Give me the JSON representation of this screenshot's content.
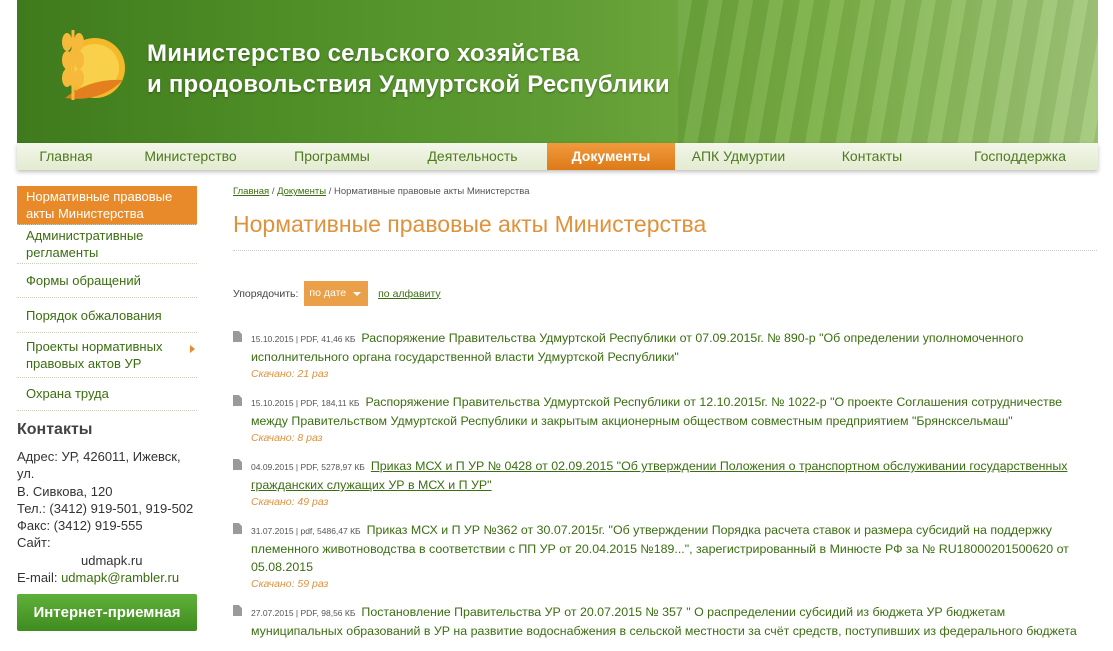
{
  "header": {
    "title_line1": "Министерство сельского хозяйства",
    "title_line2": "и продовольствия Удмуртской Республики"
  },
  "nav": {
    "items": [
      "Главная",
      "Министерство",
      "Программы",
      "Деятельность",
      "Документы",
      "АПК Удмуртии",
      "Контакты",
      "Господдержка"
    ],
    "active": "Документы"
  },
  "sidebar": {
    "items": [
      "Нормативные правовые акты Министерства",
      "Административные регламенты",
      "Формы обращений",
      "Порядок обжалования",
      "Проекты нормативных правовых актов УР",
      "Охрана труда"
    ],
    "active_index": 0
  },
  "contacts": {
    "title": "Контакты",
    "address_1": "Адрес: УР, 426011, Ижевск, ул.",
    "address_2": "В. Сивкова, 120",
    "phone": "Тел.: (3412) 919-501, 919-502",
    "fax": "Факс: (3412) 919-555",
    "site_label": "Сайт:",
    "site": "udmapk.ru",
    "email_label": "E-mail:",
    "email": "udmapk@rambler.ru",
    "reception_button": "Интернет-приемная"
  },
  "breadcrumb": {
    "home": "Главная",
    "sep": "/",
    "docs": "Документы",
    "current": "Нормативные правовые акты Министерства"
  },
  "main": {
    "title": "Нормативные правовые акты Министерства",
    "sort_label": "Упорядочить:",
    "sort_selected": "по дате",
    "sort_alt": "по алфавиту"
  },
  "documents": [
    {
      "meta": "15.10.2015 | PDF, 41,46 КБ",
      "title": "Распоряжение Правительства Удмуртской Республики от 07.09.2015г. № 890-р \"Об определении уполномоченного исполнительного органа государственной власти Удмуртской Республики\"",
      "downloads": "Скачано: 21 раз"
    },
    {
      "meta": "15.10.2015 | PDF, 184,11 КБ",
      "title": "Распоряжение Правительства Удмуртской Республики от 12.10.2015г. № 1022-р \"О проекте Соглашения сотрудничестве между Правительством Удмуртской Республики и закрытым акционерным обществом совместным предприятием \"Брянсксельмаш\"",
      "downloads": "Скачано: 8 раз"
    },
    {
      "meta": "04.09.2015 | PDF, 5278,97 КБ",
      "title": "Приказ МСХ и П УР № 0428 от 02.09.2015 \"Об утверждении Положения о транспортном обслуживании государственных гражданских служащих УР в МСХ и П УР\"",
      "downloads": "Скачано: 49 раз"
    },
    {
      "meta": "31.07.2015 | pdf, 5486,47 КБ",
      "title": "Приказ МСХ и П УР №362 от 30.07.2015г. \"Об утверждении Порядка расчета ставок и размера субсидий на поддержку племенного животноводства в соответствии с ПП УР от 20.04.2015 №189...\", зарегистрированный в Минюсте РФ за № RU18000201500620 от 05.08.2015",
      "downloads": "Скачано: 59 раз"
    },
    {
      "meta": "27.07.2015 | PDF, 98,56 КБ",
      "title": "Постановление Правительства УР от 20.07.2015 № 357 \" О распределении субсидий из бюджета УР бюджетам муниципальных образований в УР на развитие водоснабжения в сельской местности за счёт средств, поступивших из федерального бюджета",
      "downloads": ""
    }
  ]
}
